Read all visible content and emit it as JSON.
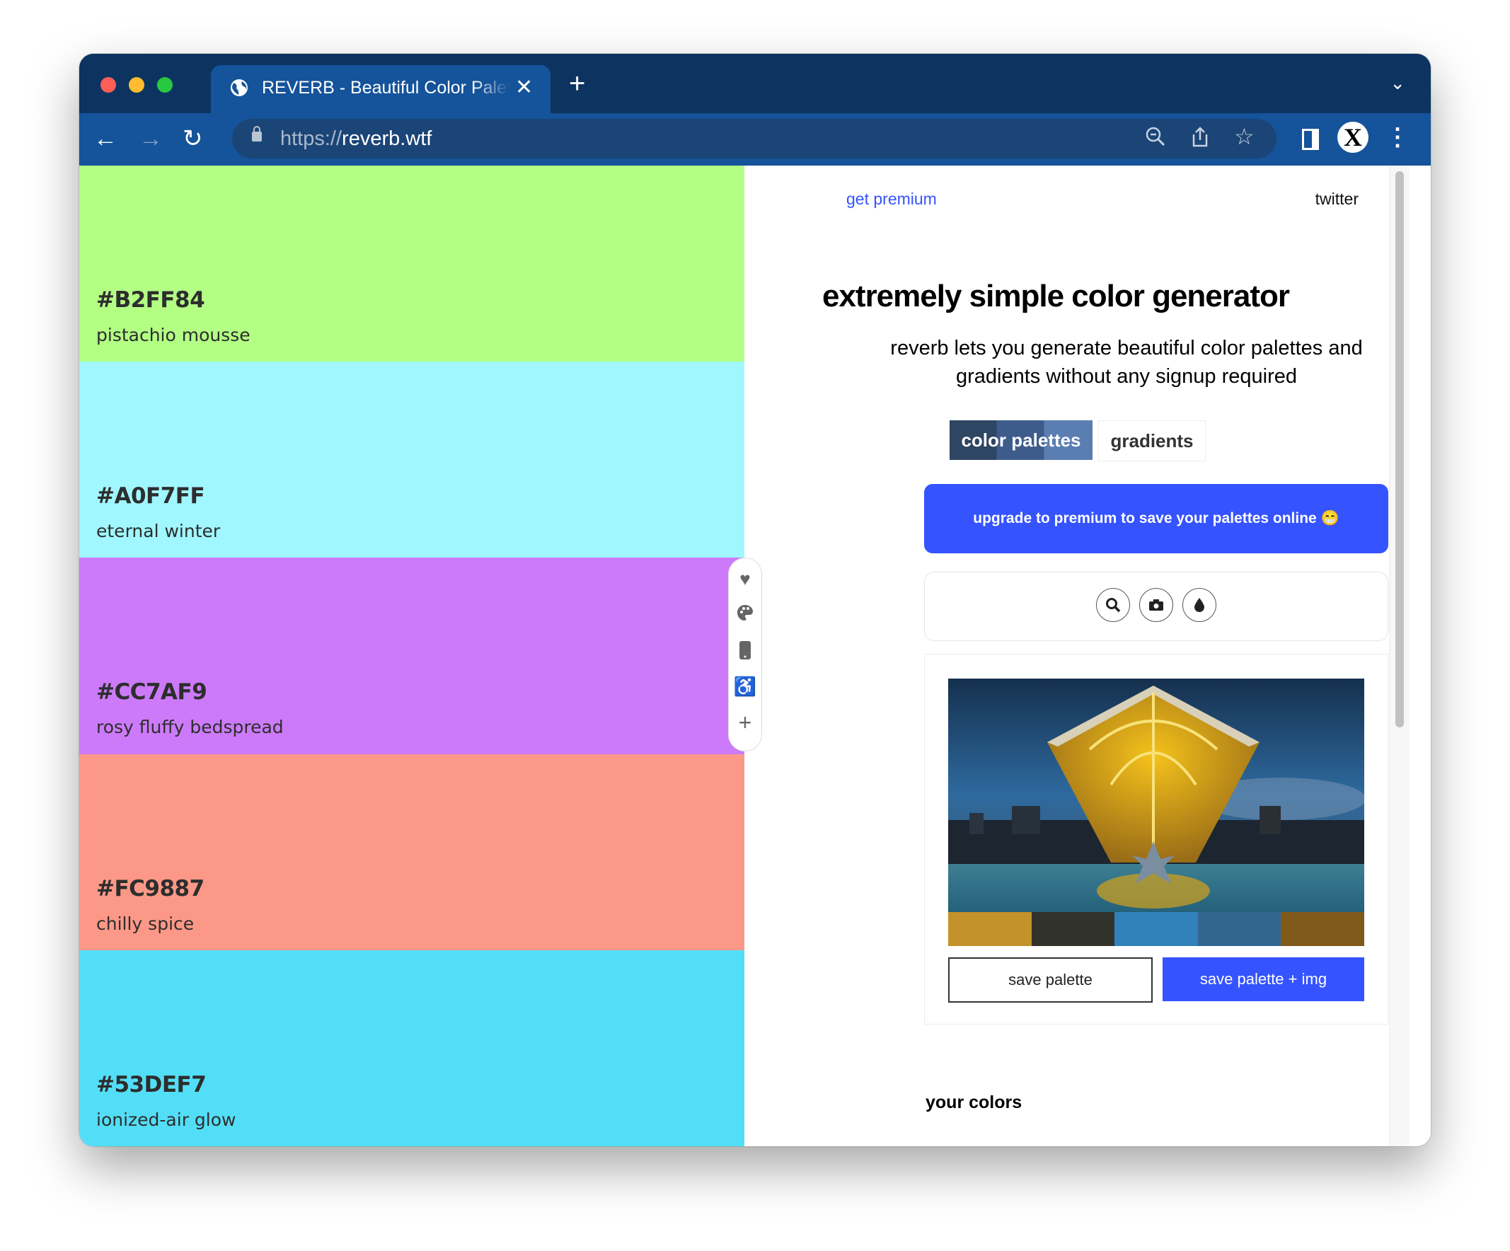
{
  "browser": {
    "tab_title": "REVERB - Beautiful Color Palettes",
    "tab_icon": "globe-icon",
    "url_scheme": "https://",
    "url_host": "reverb.wtf",
    "profile_initial": "X",
    "traffic_lights": {
      "close": "#ff5f57",
      "minimize": "#febc2e",
      "maximize": "#28c840"
    }
  },
  "palette": [
    {
      "hex": "#B2FF84",
      "name": "pistachio mousse"
    },
    {
      "hex": "#A0F7FF",
      "name": "eternal winter"
    },
    {
      "hex": "#CC7AF9",
      "name": "rosy fluffy bedspread"
    },
    {
      "hex": "#FC9887",
      "name": "chilly spice"
    },
    {
      "hex": "#53DEF7",
      "name": "ionized-air glow"
    }
  ],
  "side_tools": [
    "heart-icon",
    "palette-icon",
    "mobile-icon",
    "accessibility-icon",
    "plus-icon"
  ],
  "header": {
    "get_premium": "get premium",
    "twitter": "twitter"
  },
  "hero": {
    "title": "extremely simple color generator",
    "subtitle": "reverb lets you generate beautiful color palettes and gradients without any signup required"
  },
  "tabs": {
    "active": "color palettes",
    "inactive": "gradients"
  },
  "upgrade": {
    "label": "upgrade to premium to save your palettes online 😁",
    "color": "#3553ff"
  },
  "image_tools": [
    "search-icon",
    "camera-icon",
    "droplet-icon"
  ],
  "extracted_palette": [
    "#C4922A",
    "#31332B",
    "#3182BA",
    "#33668E",
    "#80581A"
  ],
  "buttons": {
    "save_palette": "save palette",
    "save_palette_img": "save palette + img"
  },
  "your_colors": "your colors"
}
